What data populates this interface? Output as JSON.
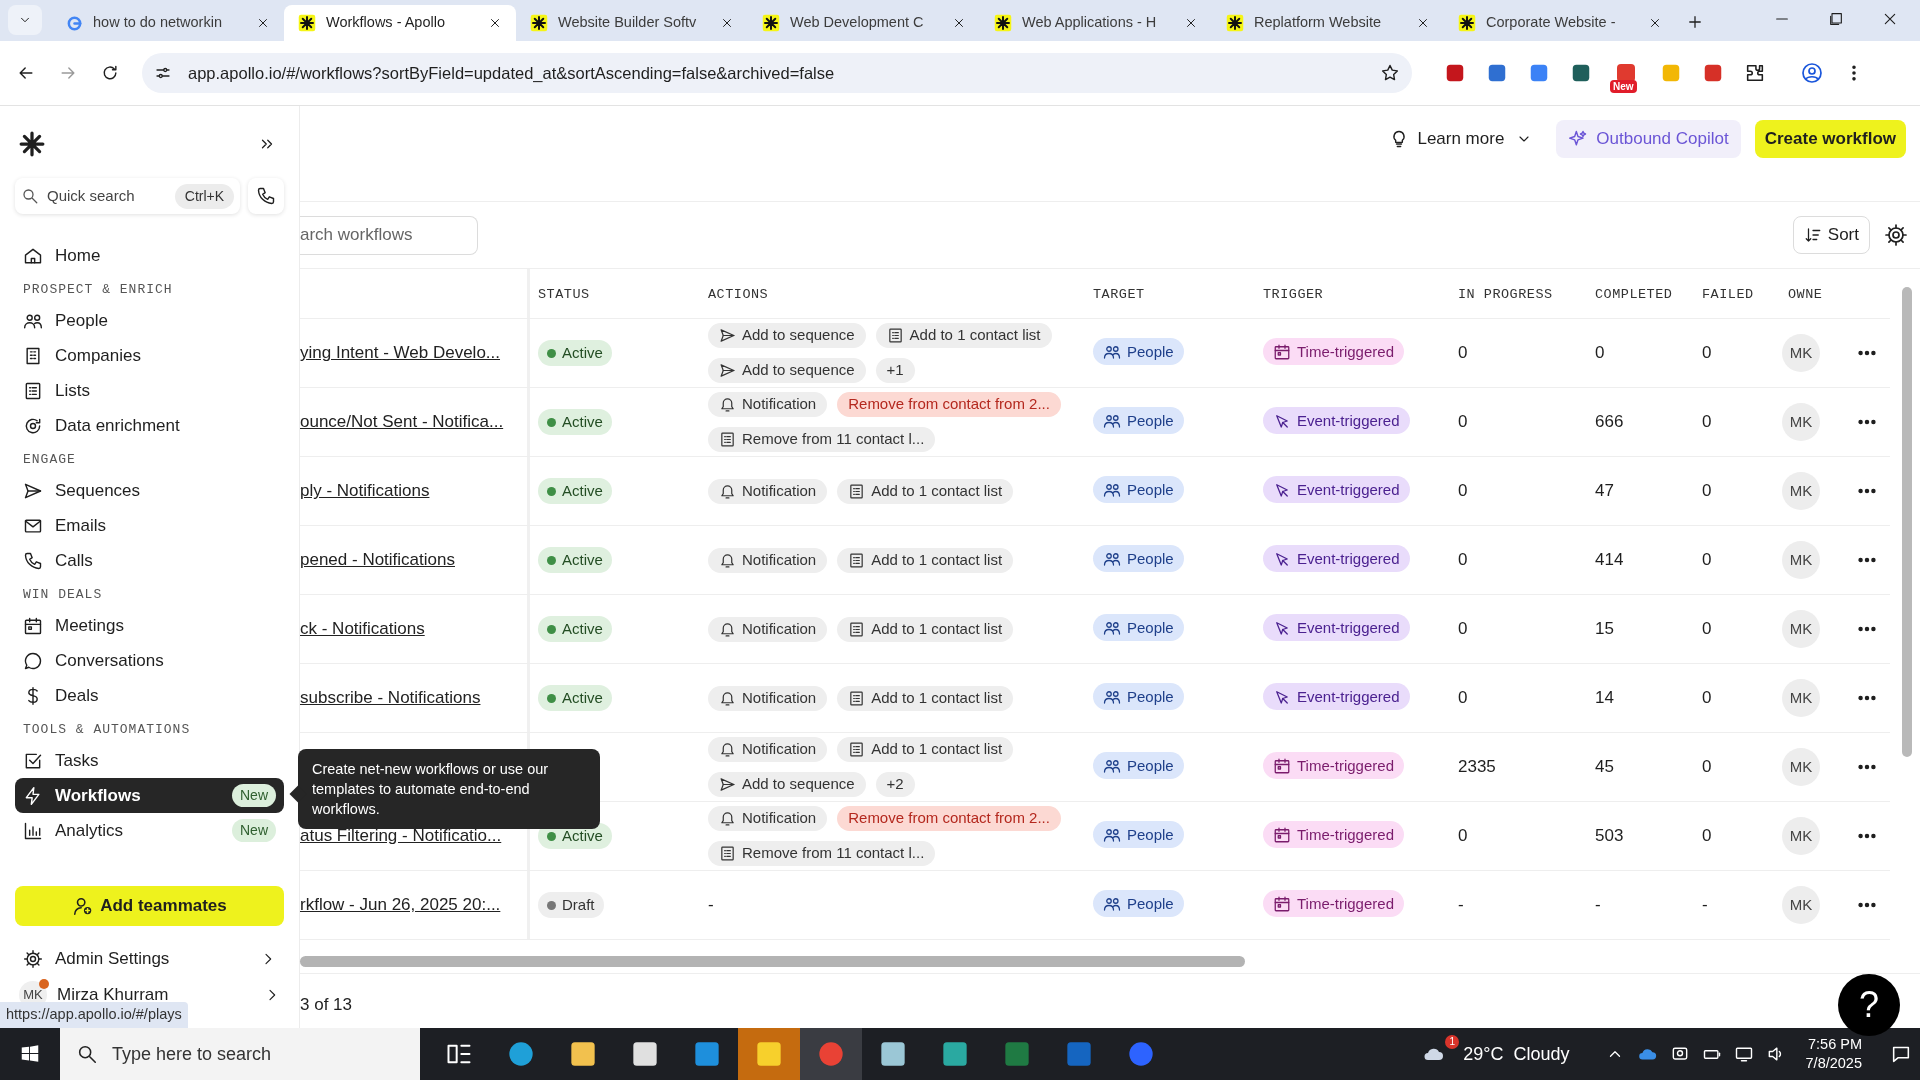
{
  "browser": {
    "tabs": [
      {
        "title": "how to do networkin",
        "kind": "google",
        "selected": false
      },
      {
        "title": "Workflows - Apollo",
        "kind": "apollo",
        "selected": true
      },
      {
        "title": "Website Builder Softv",
        "kind": "apollo",
        "selected": false
      },
      {
        "title": "Web Development C",
        "kind": "apollo",
        "selected": false
      },
      {
        "title": "Web Applications - H",
        "kind": "apollo",
        "selected": false
      },
      {
        "title": "Replatform Website",
        "kind": "apollo",
        "selected": false
      },
      {
        "title": "Corporate Website -",
        "kind": "apollo",
        "selected": false
      }
    ],
    "url": "app.apollo.io/#/workflows?sortByField=updated_at&sortAscending=false&archived=false",
    "extension_badge": "New"
  },
  "sidebar": {
    "quick_search": {
      "placeholder": "Quick search",
      "shortcut": "Ctrl+K"
    },
    "items": [
      {
        "kind": "link",
        "label": "Home",
        "selected": false
      },
      {
        "kind": "section",
        "label": "PROSPECT & ENRICH"
      },
      {
        "kind": "link",
        "label": "People",
        "selected": false
      },
      {
        "kind": "link",
        "label": "Companies",
        "selected": false
      },
      {
        "kind": "link",
        "label": "Lists",
        "selected": false
      },
      {
        "kind": "link",
        "label": "Data enrichment",
        "selected": false
      },
      {
        "kind": "section",
        "label": "ENGAGE"
      },
      {
        "kind": "link",
        "label": "Sequences",
        "selected": false
      },
      {
        "kind": "link",
        "label": "Emails",
        "selected": false
      },
      {
        "kind": "link",
        "label": "Calls",
        "selected": false
      },
      {
        "kind": "section",
        "label": "WIN DEALS"
      },
      {
        "kind": "link",
        "label": "Meetings",
        "selected": false
      },
      {
        "kind": "link",
        "label": "Conversations",
        "selected": false
      },
      {
        "kind": "link",
        "label": "Deals",
        "selected": false
      },
      {
        "kind": "section",
        "label": "TOOLS & AUTOMATIONS"
      },
      {
        "kind": "link",
        "label": "Tasks",
        "selected": false
      },
      {
        "kind": "link",
        "label": "Workflows",
        "selected": true,
        "badge": "New"
      },
      {
        "kind": "link",
        "label": "Analytics",
        "selected": false,
        "badge": "New"
      }
    ],
    "add_button": "Add teammates",
    "admin": "Admin Settings",
    "user": {
      "initials": "MK",
      "name": "Mirza Khurram",
      "has_alert": true
    }
  },
  "tooltip": "Create net-new workflows or use our templates to automate end-to-end workflows.",
  "status_url": "https://app.apollo.io/#/plays",
  "header": {
    "learn_more": "Learn more",
    "copilot": "Outbound Copilot",
    "create": "Create workflow"
  },
  "search": {
    "placeholder": "arch workflows"
  },
  "sort": "Sort",
  "table": {
    "columns": [
      {
        "label": "STATUS"
      },
      {
        "label": "ACTIONS"
      },
      {
        "label": "TARGET"
      },
      {
        "label": "TRIGGER"
      },
      {
        "label": "IN PROGRESS"
      },
      {
        "label": "COMPLETED"
      },
      {
        "label": "FAILED"
      },
      {
        "label": "OWNE"
      }
    ],
    "rows": [
      {
        "name": "ying Intent - Web Develo...",
        "status": {
          "kind": "active",
          "label": "Active"
        },
        "actions": [
          {
            "kind": "sequence",
            "label": "Add to sequence"
          },
          {
            "kind": "list",
            "label": "Add to 1 contact list"
          },
          {
            "kind": "sequence",
            "label": "Add to sequence"
          },
          {
            "kind": "more",
            "label": "+1"
          }
        ],
        "target": "People",
        "trigger": {
          "kind": "time",
          "label": "Time-triggered"
        },
        "in_progress": "0",
        "completed": "0",
        "failed": "0",
        "owner": "MK"
      },
      {
        "name": "ounce/Not Sent - Notifica...",
        "status": {
          "kind": "active",
          "label": "Active"
        },
        "actions": [
          {
            "kind": "notification",
            "label": "Notification"
          },
          {
            "kind": "remove",
            "label": "Remove from contact from 2..."
          },
          {
            "kind": "list",
            "label": "Remove from 11 contact l..."
          }
        ],
        "target": "People",
        "trigger": {
          "kind": "event",
          "label": "Event-triggered"
        },
        "in_progress": "0",
        "completed": "666",
        "failed": "0",
        "owner": "MK"
      },
      {
        "name": "ply - Notifications",
        "status": {
          "kind": "active",
          "label": "Active"
        },
        "actions": [
          {
            "kind": "notification",
            "label": "Notification"
          },
          {
            "kind": "list",
            "label": "Add to 1 contact list"
          }
        ],
        "target": "People",
        "trigger": {
          "kind": "event",
          "label": "Event-triggered"
        },
        "in_progress": "0",
        "completed": "47",
        "failed": "0",
        "owner": "MK"
      },
      {
        "name": "pened - Notifications",
        "status": {
          "kind": "active",
          "label": "Active"
        },
        "actions": [
          {
            "kind": "notification",
            "label": "Notification"
          },
          {
            "kind": "list",
            "label": "Add to 1 contact list"
          }
        ],
        "target": "People",
        "trigger": {
          "kind": "event",
          "label": "Event-triggered"
        },
        "in_progress": "0",
        "completed": "414",
        "failed": "0",
        "owner": "MK"
      },
      {
        "name": "ck - Notifications",
        "status": {
          "kind": "active",
          "label": "Active"
        },
        "actions": [
          {
            "kind": "notification",
            "label": "Notification"
          },
          {
            "kind": "list",
            "label": "Add to 1 contact list"
          }
        ],
        "target": "People",
        "trigger": {
          "kind": "event",
          "label": "Event-triggered"
        },
        "in_progress": "0",
        "completed": "15",
        "failed": "0",
        "owner": "MK"
      },
      {
        "name": "subscribe - Notifications",
        "status": {
          "kind": "active",
          "label": "Active"
        },
        "actions": [
          {
            "kind": "notification",
            "label": "Notification"
          },
          {
            "kind": "list",
            "label": "Add to 1 contact list"
          }
        ],
        "target": "People",
        "trigger": {
          "kind": "event",
          "label": "Event-triggered"
        },
        "in_progress": "0",
        "completed": "14",
        "failed": "0",
        "owner": "MK"
      },
      {
        "actions": [
          {
            "kind": "notification",
            "label": "Notification"
          },
          {
            "kind": "list",
            "label": "Add to 1 contact list"
          },
          {
            "kind": "sequence",
            "label": "Add to sequence"
          },
          {
            "kind": "more",
            "label": "+2"
          }
        ],
        "target": "People",
        "trigger": {
          "kind": "time",
          "label": "Time-triggered"
        },
        "in_progress": "2335",
        "completed": "45",
        "failed": "0",
        "owner": "MK"
      },
      {
        "name": "atus Filtering - Notificatio...",
        "status": {
          "kind": "active",
          "label": "Active"
        },
        "actions": [
          {
            "kind": "notification",
            "label": "Notification"
          },
          {
            "kind": "remove",
            "label": "Remove from contact from 2..."
          },
          {
            "kind": "list",
            "label": "Remove from 11 contact l..."
          }
        ],
        "target": "People",
        "trigger": {
          "kind": "time",
          "label": "Time-triggered"
        },
        "in_progress": "0",
        "completed": "503",
        "failed": "0",
        "owner": "MK"
      },
      {
        "name": "rkflow - Jun 26, 2025 20:...",
        "status": {
          "kind": "draft",
          "label": "Draft"
        },
        "no_actions": "-",
        "target": "People",
        "trigger": {
          "kind": "time",
          "label": "Time-triggered"
        },
        "in_progress": "-",
        "completed": "-",
        "failed": "-",
        "owner": "MK"
      }
    ]
  },
  "pagination": "3 of 13",
  "help": "?",
  "taskbar": {
    "search_placeholder": "Type here to search",
    "weather_badge": "1",
    "weather": "29°C  Cloudy",
    "time": "7:56 PM",
    "date": "7/8/2025"
  }
}
